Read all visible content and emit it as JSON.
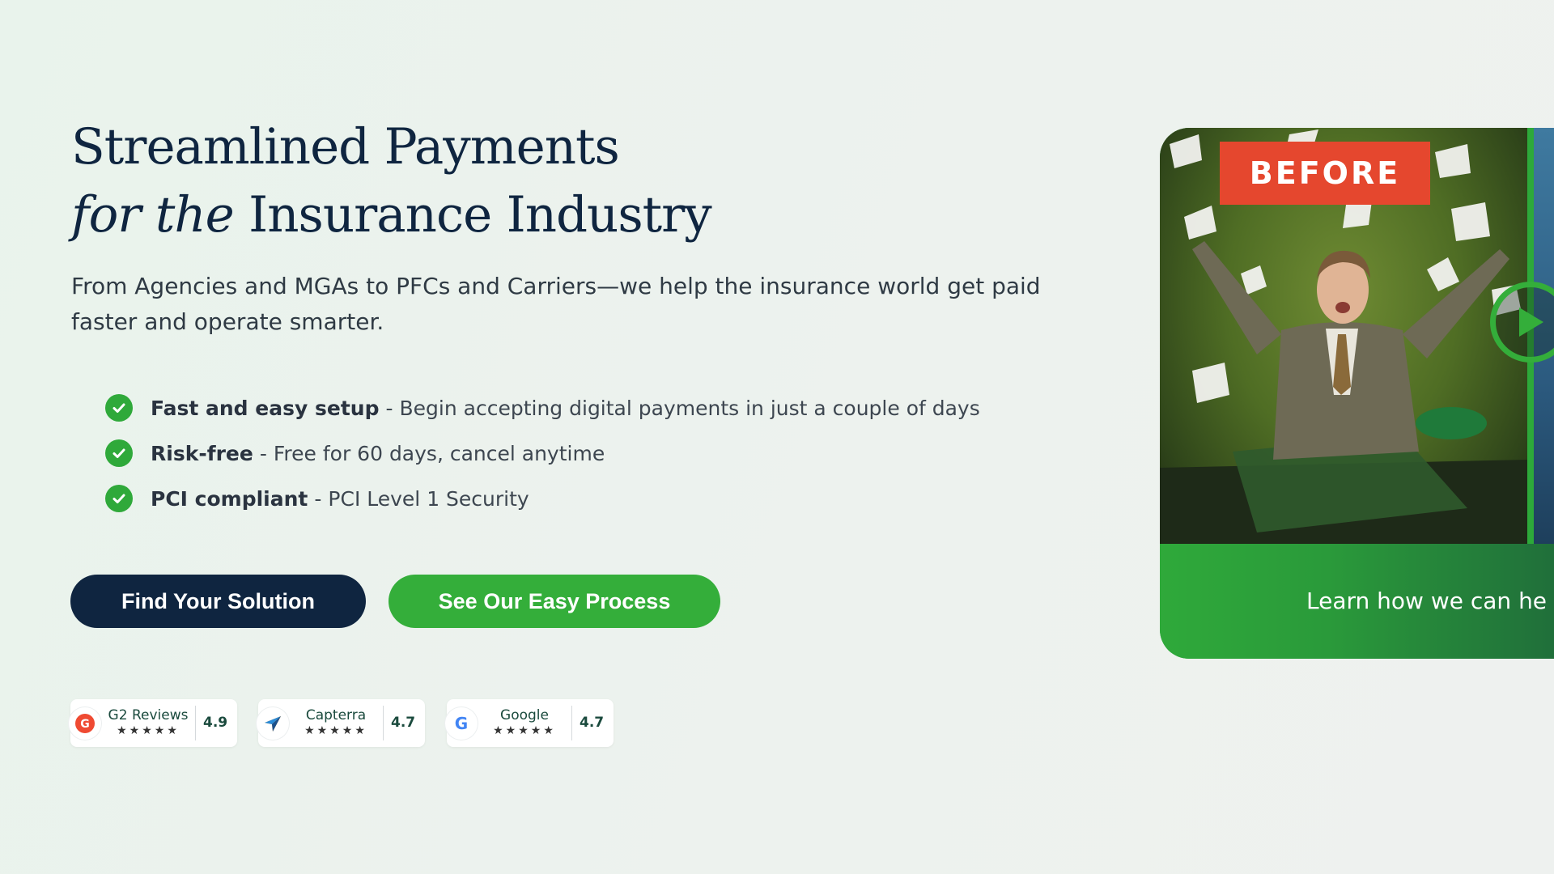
{
  "hero": {
    "title_line1": "Streamlined Payments",
    "title_line2_italic": "for the",
    "title_line2_rest": "Insurance Industry",
    "subtitle": "From Agencies and MGAs to PFCs and Carriers—we help the insurance world get paid faster and operate smarter."
  },
  "features": [
    {
      "title": "Fast and easy setup",
      "separator": "-",
      "description": "Begin accepting digital payments in just a couple of days"
    },
    {
      "title": "Risk-free",
      "separator": "-",
      "description": "Free for 60 days, cancel anytime"
    },
    {
      "title": "PCI compliant",
      "separator": "-",
      "description": "PCI Level 1 Security"
    }
  ],
  "buttons": {
    "primary": "Find Your Solution",
    "secondary": "See Our Easy Process"
  },
  "reviews": [
    {
      "name": "G2 Reviews",
      "stars": "★★★★★",
      "score": "4.9",
      "icon": "g2-logo-icon"
    },
    {
      "name": "Capterra",
      "stars": "★★★★★",
      "score": "4.7",
      "icon": "capterra-logo-icon"
    },
    {
      "name": "Google",
      "stars": "★★★★★",
      "score": "4.7",
      "icon": "google-logo-icon"
    }
  ],
  "video": {
    "badge": "BEFORE",
    "caption": "Learn how we can he"
  },
  "colors": {
    "navy": "#0f2540",
    "green": "#34ae3a",
    "before_badge": "#e5472e",
    "background": "#e9f3ec"
  }
}
